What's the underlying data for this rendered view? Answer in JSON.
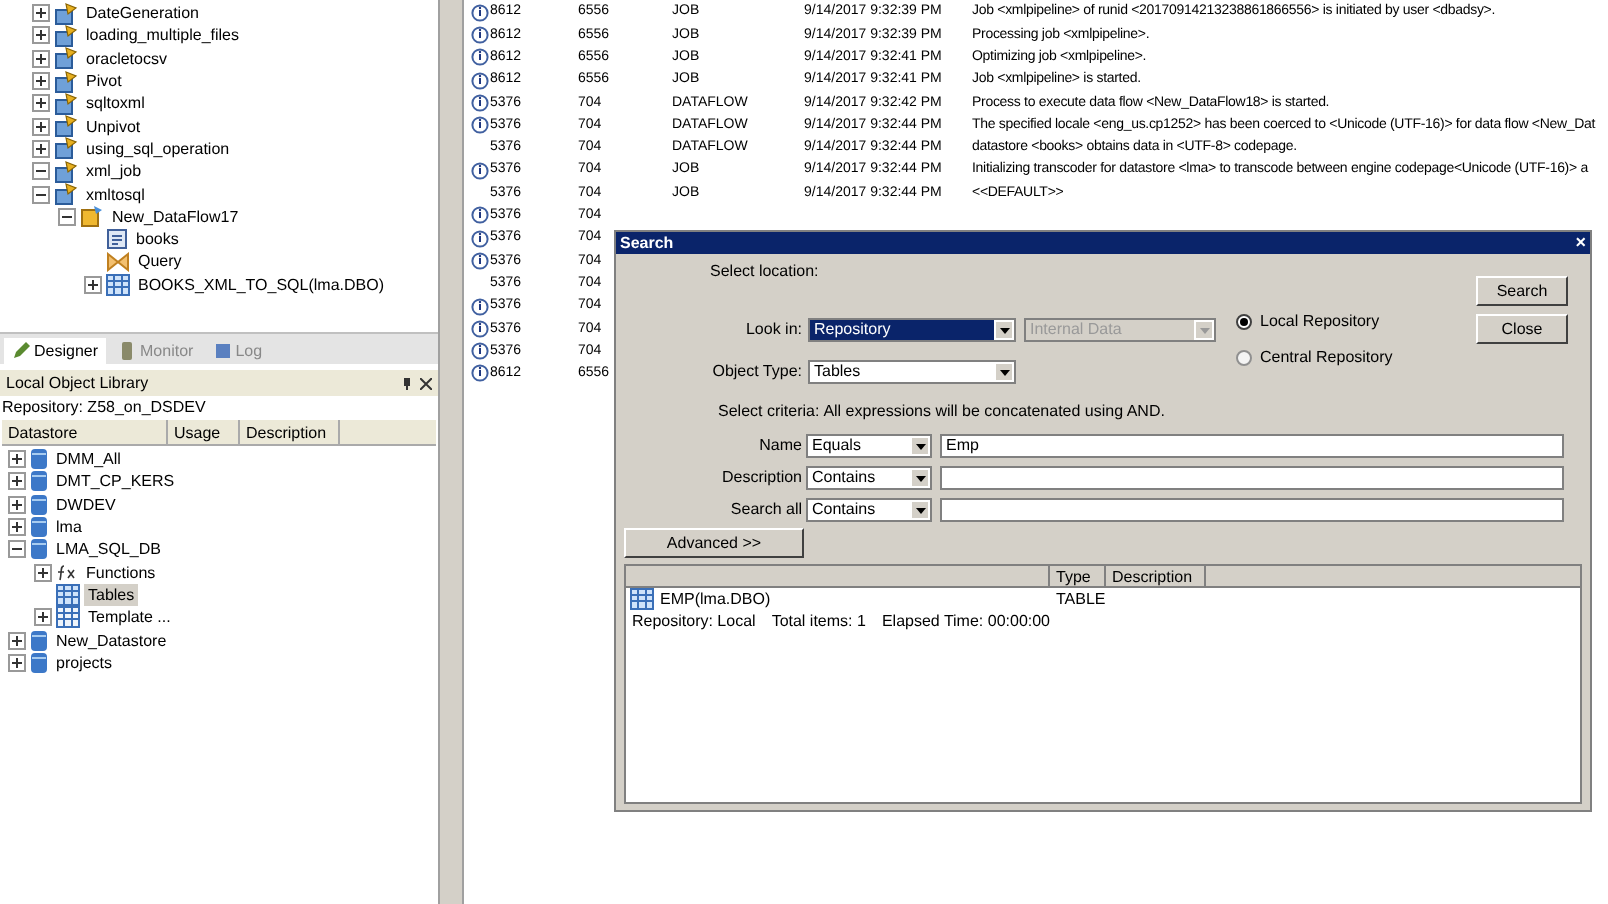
{
  "project_tree": [
    {
      "label": "DateGeneration",
      "kind": "job",
      "expanded": false
    },
    {
      "label": "loading_multiple_files",
      "kind": "job",
      "expanded": false
    },
    {
      "label": "oracletocsv",
      "kind": "job",
      "expanded": false
    },
    {
      "label": "Pivot",
      "kind": "job",
      "expanded": false
    },
    {
      "label": "sqltoxml",
      "kind": "job",
      "expanded": false
    },
    {
      "label": "Unpivot",
      "kind": "job",
      "expanded": false
    },
    {
      "label": "using_sql_operation",
      "kind": "job",
      "expanded": false
    },
    {
      "label": "xml_job",
      "kind": "job",
      "expanded": true
    },
    {
      "label": "xmltosql",
      "kind": "job",
      "expanded": true,
      "children": [
        {
          "label": "New_DataFlow17",
          "kind": "dataflow",
          "expanded": true,
          "children": [
            {
              "label": "books",
              "kind": "xml"
            },
            {
              "label": "Query",
              "kind": "query"
            },
            {
              "label": "BOOKS_XML_TO_SQL(lma.DBO)",
              "kind": "table",
              "expanded": false
            }
          ]
        }
      ]
    }
  ],
  "tabs": [
    {
      "label": "Designer",
      "selected": true
    },
    {
      "label": "Monitor",
      "selected": false
    },
    {
      "label": "Log",
      "selected": false
    }
  ],
  "library": {
    "title": "Local Object Library",
    "repository": "Repository: Z58_on_DSDEV",
    "columns": [
      "Datastore",
      "Usage",
      "Description"
    ],
    "items": [
      {
        "label": "DMM_All",
        "kind": "datastore",
        "expanded": false,
        "selected": false
      },
      {
        "label": "DMT_CP_KERS",
        "kind": "datastore",
        "expanded": false,
        "selected": false
      },
      {
        "label": "DWDEV",
        "kind": "datastore",
        "expanded": false,
        "selected": false
      },
      {
        "label": "lma",
        "kind": "datastore",
        "expanded": false,
        "selected": false
      },
      {
        "label": "LMA_SQL_DB",
        "kind": "datastore",
        "expanded": true,
        "selected": false,
        "children": [
          {
            "label": "Functions",
            "kind": "function",
            "expanded": false,
            "selected": false
          },
          {
            "label": "Tables",
            "kind": "table",
            "selected": true
          },
          {
            "label": "Template ...",
            "kind": "template",
            "expanded": false,
            "selected": false
          }
        ]
      },
      {
        "label": "New_Datastore",
        "kind": "datastore",
        "expanded": false,
        "selected": false
      },
      {
        "label": "projects",
        "kind": "datastore",
        "expanded": false,
        "selected": false
      }
    ]
  },
  "log_rows": [
    {
      "icon": true,
      "id": "8612",
      "thread": "6556",
      "type": "JOB",
      "time": "9/14/2017 9:32:39 PM",
      "message": "Job <xmlpipeline> of runid <20170914213238861866556> is initiated by user <dbadsy>."
    },
    {
      "icon": true,
      "id": "8612",
      "thread": "6556",
      "type": "JOB",
      "time": "9/14/2017 9:32:39 PM",
      "message": "Processing job <xmlpipeline>."
    },
    {
      "icon": true,
      "id": "8612",
      "thread": "6556",
      "type": "JOB",
      "time": "9/14/2017 9:32:41 PM",
      "message": "Optimizing job <xmlpipeline>."
    },
    {
      "icon": true,
      "id": "8612",
      "thread": "6556",
      "type": "JOB",
      "time": "9/14/2017 9:32:41 PM",
      "message": "Job <xmlpipeline> is started."
    },
    {
      "icon": true,
      "id": "5376",
      "thread": "704",
      "type": "DATAFLOW",
      "time": "9/14/2017 9:32:42 PM",
      "message": "Process to execute data flow <New_DataFlow18> is started."
    },
    {
      "icon": true,
      "id": "5376",
      "thread": "704",
      "type": "DATAFLOW",
      "time": "9/14/2017 9:32:44 PM",
      "message": "The specified locale <eng_us.cp1252> has been coerced to <Unicode (UTF-16)> for data flow <New_Dat"
    },
    {
      "icon": false,
      "id": "5376",
      "thread": "704",
      "type": "DATAFLOW",
      "time": "9/14/2017 9:32:44 PM",
      "message": "datastore <books> obtains data in <UTF-8> codepage."
    },
    {
      "icon": true,
      "id": "5376",
      "thread": "704",
      "type": "JOB",
      "time": "9/14/2017 9:32:44 PM",
      "message": "Initializing transcoder for datastore <lma> to transcode between engine codepage<Unicode (UTF-16)> a"
    },
    {
      "icon": false,
      "id": "5376",
      "thread": "704",
      "type": "JOB",
      "time": "9/14/2017 9:32:44 PM",
      "message": "<<DEFAULT>>"
    },
    {
      "icon": true,
      "id": "5376",
      "thread": "704"
    },
    {
      "icon": true,
      "id": "5376",
      "thread": "704"
    },
    {
      "icon": true,
      "id": "5376",
      "thread": "704"
    },
    {
      "icon": false,
      "id": "5376",
      "thread": "704"
    },
    {
      "icon": true,
      "id": "5376",
      "thread": "704"
    },
    {
      "icon": true,
      "id": "5376",
      "thread": "704"
    },
    {
      "icon": true,
      "id": "5376",
      "thread": "704"
    },
    {
      "icon": true,
      "id": "8612",
      "thread": "6556"
    }
  ],
  "dialog": {
    "title": "Search",
    "close": "×",
    "location_label": "Select location:",
    "look_in": {
      "label": "Look in:",
      "value": "Repository",
      "scope": "Internal Data",
      "scope_disabled": true
    },
    "object_type": {
      "label": "Object Type:",
      "value": "Tables"
    },
    "radios": [
      {
        "label": "Local Repository",
        "selected": true
      },
      {
        "label": "Central Repository",
        "selected": false
      }
    ],
    "buttons": [
      "Search",
      "Close"
    ],
    "criteria_label": "Select criteria:",
    "criteria_note": "All expressions will be concatenated using AND.",
    "criteria": [
      {
        "label": "Name",
        "operator": "Equals",
        "value": "Emp"
      },
      {
        "label": "Description",
        "operator": "Contains"
      },
      {
        "label": "Search all",
        "operator": "Contains"
      }
    ],
    "advanced": "Advanced >>",
    "results": {
      "columns": [
        "",
        "Type",
        "Description"
      ],
      "rows": [
        {
          "name": "EMP(lma.DBO)",
          "type": "TABLE"
        }
      ]
    },
    "status": [
      "Repository: Local",
      "Total items: 1",
      "Elapsed Time: 00:00:00"
    ]
  }
}
